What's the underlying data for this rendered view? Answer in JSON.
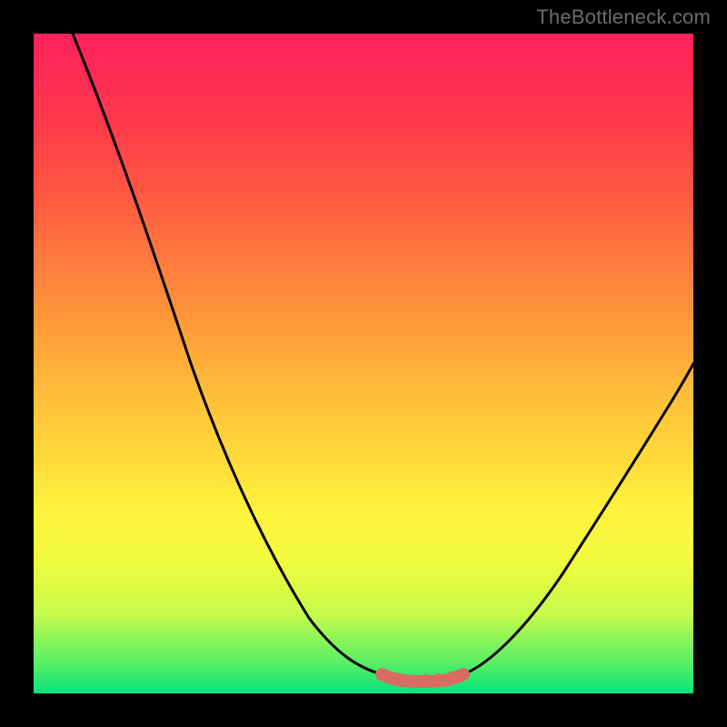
{
  "attribution": "TheBottleneck.com",
  "colors": {
    "page_bg": "#000000",
    "gradient_top": "#ff225b",
    "gradient_bottom": "#07e27d",
    "curve_stroke": "#000000",
    "flat_segment_stroke": "#d96b63",
    "attribution_text": "#6c6c6c"
  },
  "chart_data": {
    "type": "line",
    "title": "",
    "xlabel": "",
    "ylabel": "",
    "xlim": [
      0,
      100
    ],
    "ylim": [
      0,
      100
    ],
    "grid": false,
    "series": [
      {
        "name": "left-curve",
        "x": [
          6,
          10,
          14,
          18,
          22,
          26,
          30,
          34,
          38,
          42,
          46,
          50,
          53
        ],
        "values": [
          100,
          90,
          80,
          70,
          60,
          50,
          40,
          31,
          23,
          16,
          10,
          5,
          3
        ]
      },
      {
        "name": "right-curve",
        "x": [
          65,
          70,
          75,
          80,
          85,
          90,
          95,
          100
        ],
        "values": [
          3,
          8,
          15,
          22,
          29,
          36,
          43,
          50
        ]
      },
      {
        "name": "flat-bottom-segment",
        "x": [
          53,
          55,
          58,
          61,
          63,
          65
        ],
        "values": [
          3,
          2.2,
          2,
          2,
          2.2,
          3
        ]
      }
    ],
    "annotations": []
  }
}
